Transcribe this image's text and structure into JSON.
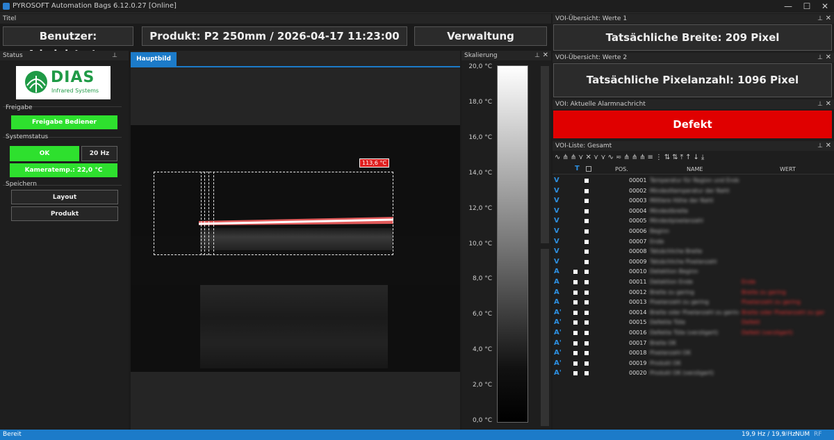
{
  "window": {
    "title": "PYROSOFT Automation Bags 6.12.0.27  [Online]",
    "minimize": "—",
    "maximize": "☐",
    "close": "✕"
  },
  "titel_panel": {
    "label": "Titel",
    "user": "Benutzer: Administrator",
    "product": "Produkt: P2 250mm / 2026-04-17 11:23:00",
    "admin_button": "Verwaltung"
  },
  "status_panel": {
    "label": "Status",
    "logo": {
      "name": "DIAS",
      "sub": "Infrared Systems"
    },
    "freigabe_label": "Freigabe",
    "freigabe_button": "Freigabe Bediener",
    "systemstatus_label": "Systemstatus",
    "ok": "OK",
    "rate": "20 Hz",
    "camtemp": "Kameratemp.: 22,0 °C",
    "speichern_label": "Speichern",
    "layout_button": "Layout",
    "produkt_button": "Produkt"
  },
  "image_panel": {
    "tab": "Hauptbild",
    "hotspot_label": "113,6 °C"
  },
  "scale_panel": {
    "label": "Skalierung",
    "ticks": [
      "20,0 °C",
      "18,0 °C",
      "16,0 °C",
      "14,0 °C",
      "12,0 °C",
      "10,0 °C",
      "8,0 °C",
      "6,0 °C",
      "4,0 °C",
      "2,0 °C",
      "0,0 °C"
    ]
  },
  "voi_werte1": {
    "label": "VOI-Übersicht: Werte 1",
    "text": "Tatsächliche Breite: 209 Pixel"
  },
  "voi_werte2": {
    "label": "VOI-Übersicht: Werte 2",
    "text": "Tatsächliche Pixelanzahl: 1096 Pixel"
  },
  "voi_alarm": {
    "label": "VOI: Aktuelle Alarmnachricht",
    "text": "Defekt",
    "color": "#e00000"
  },
  "voi_list": {
    "label": "VOI-Liste: Gesamt",
    "headers": {
      "t": "T",
      "pos": "POS.",
      "name": "NAME",
      "wert": "WERT"
    },
    "rows": [
      {
        "icon": "V",
        "pos": "00001",
        "name": "Temperatur für Region und Ende",
        "val": "",
        "box": false
      },
      {
        "icon": "V",
        "pos": "00002",
        "name": "Mindesttemperatur der Naht",
        "val": "",
        "box": false
      },
      {
        "icon": "V",
        "pos": "00003",
        "name": "Mittlere Höhe der Naht",
        "val": "",
        "box": false
      },
      {
        "icon": "V",
        "pos": "00004",
        "name": "Mindestbreite",
        "val": "",
        "box": false
      },
      {
        "icon": "V",
        "pos": "00005",
        "name": "Mindestpixelanzahl",
        "val": "",
        "box": false
      },
      {
        "icon": "V",
        "pos": "00006",
        "name": "Beginn",
        "val": "",
        "box": false
      },
      {
        "icon": "V",
        "pos": "00007",
        "name": "Ende",
        "val": "",
        "box": false
      },
      {
        "icon": "V",
        "pos": "00008",
        "name": "Tatsächliche Breite",
        "val": "",
        "box": false
      },
      {
        "icon": "V",
        "pos": "00009",
        "name": "Tatsächliche Pixelanzahl",
        "val": "",
        "box": false
      },
      {
        "icon": "A",
        "pos": "00010",
        "name": "Detektion Beginn",
        "val": "",
        "box": true
      },
      {
        "icon": "A",
        "pos": "00011",
        "name": "Detektion Ende",
        "val": "Ende",
        "box": true
      },
      {
        "icon": "A",
        "pos": "00012",
        "name": "Breite zu gering",
        "val": "Breite zu gering",
        "box": true
      },
      {
        "icon": "A",
        "pos": "00013",
        "name": "Pixelanzahl zu gering",
        "val": "Pixelanzahl zu gering",
        "box": true
      },
      {
        "icon": "A'",
        "pos": "00014",
        "name": "Breite oder Pixelanzahl zu gering",
        "val": "Breite oder Pixelanzahl zu gering",
        "box": true
      },
      {
        "icon": "A'",
        "pos": "00015",
        "name": "Defekte Tüte",
        "val": "Defekt",
        "box": true
      },
      {
        "icon": "A'",
        "pos": "00016",
        "name": "Defekte Tüte (verzögert)",
        "val": "Defekt (verzögert)",
        "box": true
      },
      {
        "icon": "A'",
        "pos": "00017",
        "name": "Breite OK",
        "val": "",
        "box": true
      },
      {
        "icon": "A'",
        "pos": "00018",
        "name": "Pixelanzahl OK",
        "val": "",
        "box": true
      },
      {
        "icon": "A'",
        "pos": "00019",
        "name": "Produkt OK",
        "val": "",
        "box": true
      },
      {
        "icon": "A'",
        "pos": "00020",
        "name": "Produkt OK (verzögert)",
        "val": "",
        "box": true
      }
    ]
  },
  "statusbar": {
    "left": "Bereit",
    "rate": "19,9 Hz / 19,9 Hz",
    "uf": "UF",
    "num": "NUM",
    "rf": "RF"
  }
}
